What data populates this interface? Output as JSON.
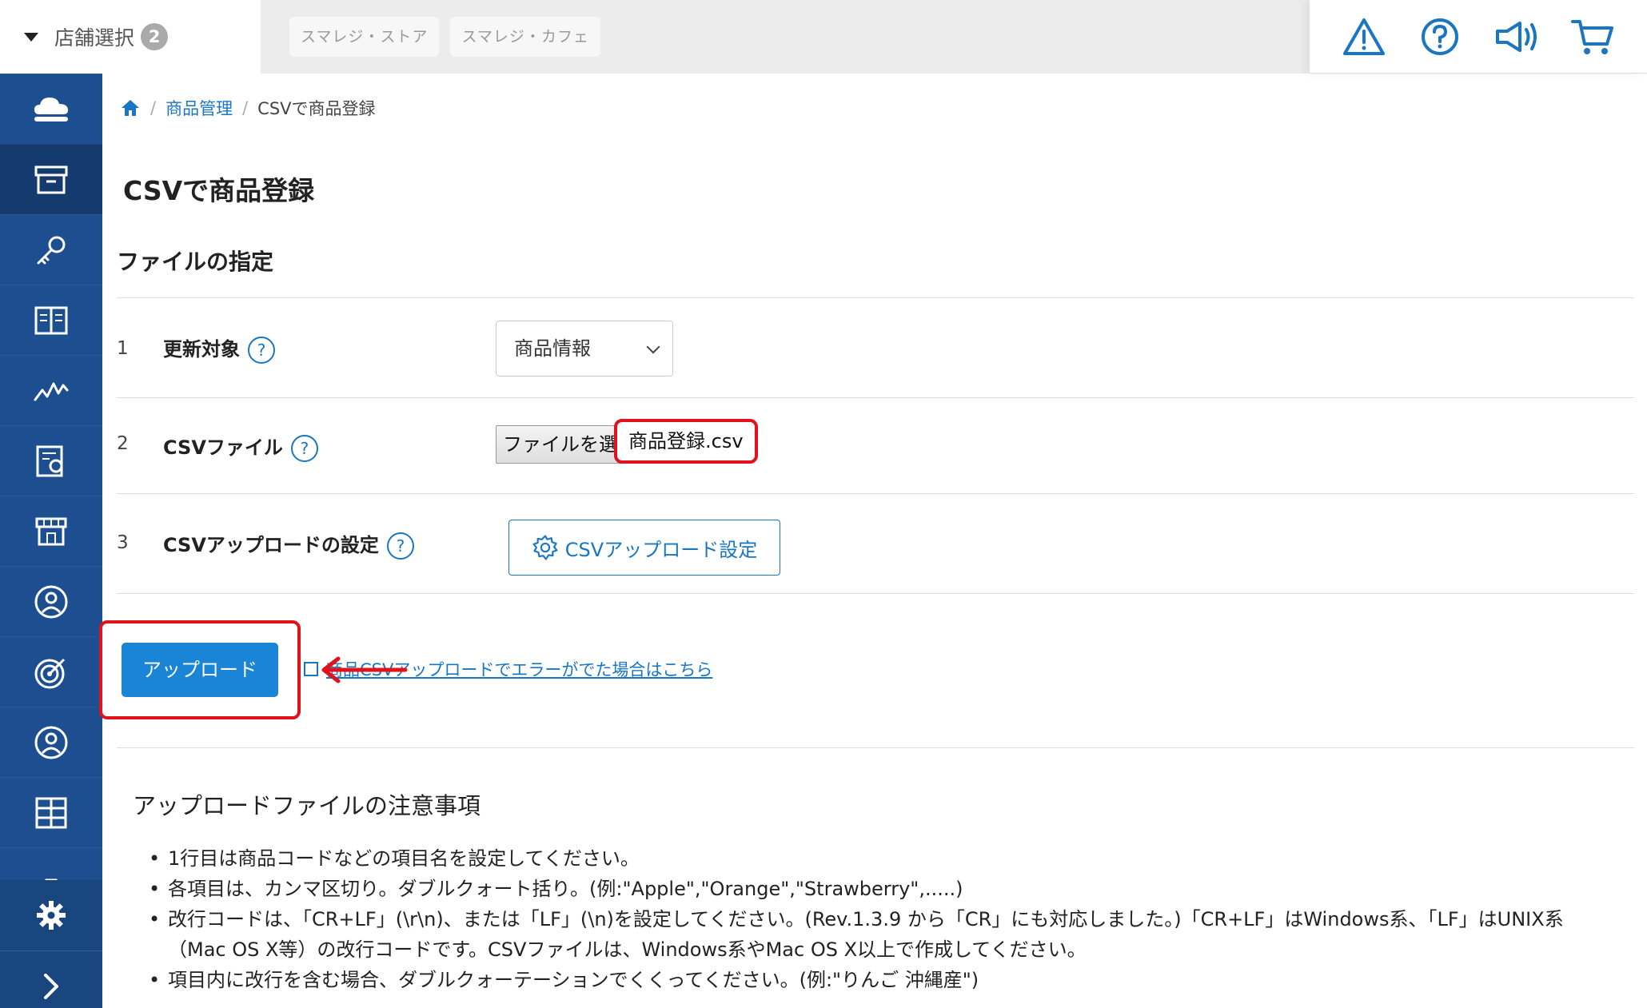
{
  "topbar": {
    "store_select_label": "店舗選択",
    "store_count": "2",
    "stores": [
      "スマレジ・ストア",
      "スマレジ・カフェ"
    ]
  },
  "breadcrumb": {
    "parent": "商品管理",
    "current": "CSVで商品登録"
  },
  "page": {
    "title": "CSVで商品登録",
    "section_title": "ファイルの指定"
  },
  "form": {
    "rows": [
      {
        "num": "1",
        "label": "更新対象",
        "help": "?"
      },
      {
        "num": "2",
        "label": "CSVファイル",
        "help": "?"
      },
      {
        "num": "3",
        "label": "CSVアップロードの設定",
        "help": "?"
      }
    ],
    "update_target_value": "商品情報",
    "file_button_label": "ファイルを選択",
    "file_name": "商品登録.csv",
    "csv_setting_button": "CSVアップロード設定"
  },
  "actions": {
    "upload_label": "アップロード",
    "error_link": "商品CSVアップロードでエラーがでた場合はこちら"
  },
  "notes": {
    "title": "アップロードファイルの注意事項",
    "items": [
      "1行目は商品コードなどの項目名を設定してください。",
      "各項目は、カンマ区切り。ダブルクォート括り。(例:\"Apple\",\"Orange\",\"Strawberry\",.....)",
      "改行コードは、「CR+LF」(\\r\\n)、または「LF」(\\n)を設定してください。(Rev.1.3.9 から「CR」にも対応しました。)「CR+LF」はWindows系、「LF」はUNIX系（Mac OS X等）の改行コードです。CSVファイルは、Windows系やMac OS X以上で作成してください。",
      "項目内に改行を含む場合、ダブルクォーテーションでくくってください。(例:\"りんご 沖縄産\")"
    ]
  },
  "colors": {
    "sidebar": "#1d4e8f",
    "accent": "#1976c2",
    "primary_button": "#1a84d6",
    "highlight_red": "#e0131c"
  }
}
